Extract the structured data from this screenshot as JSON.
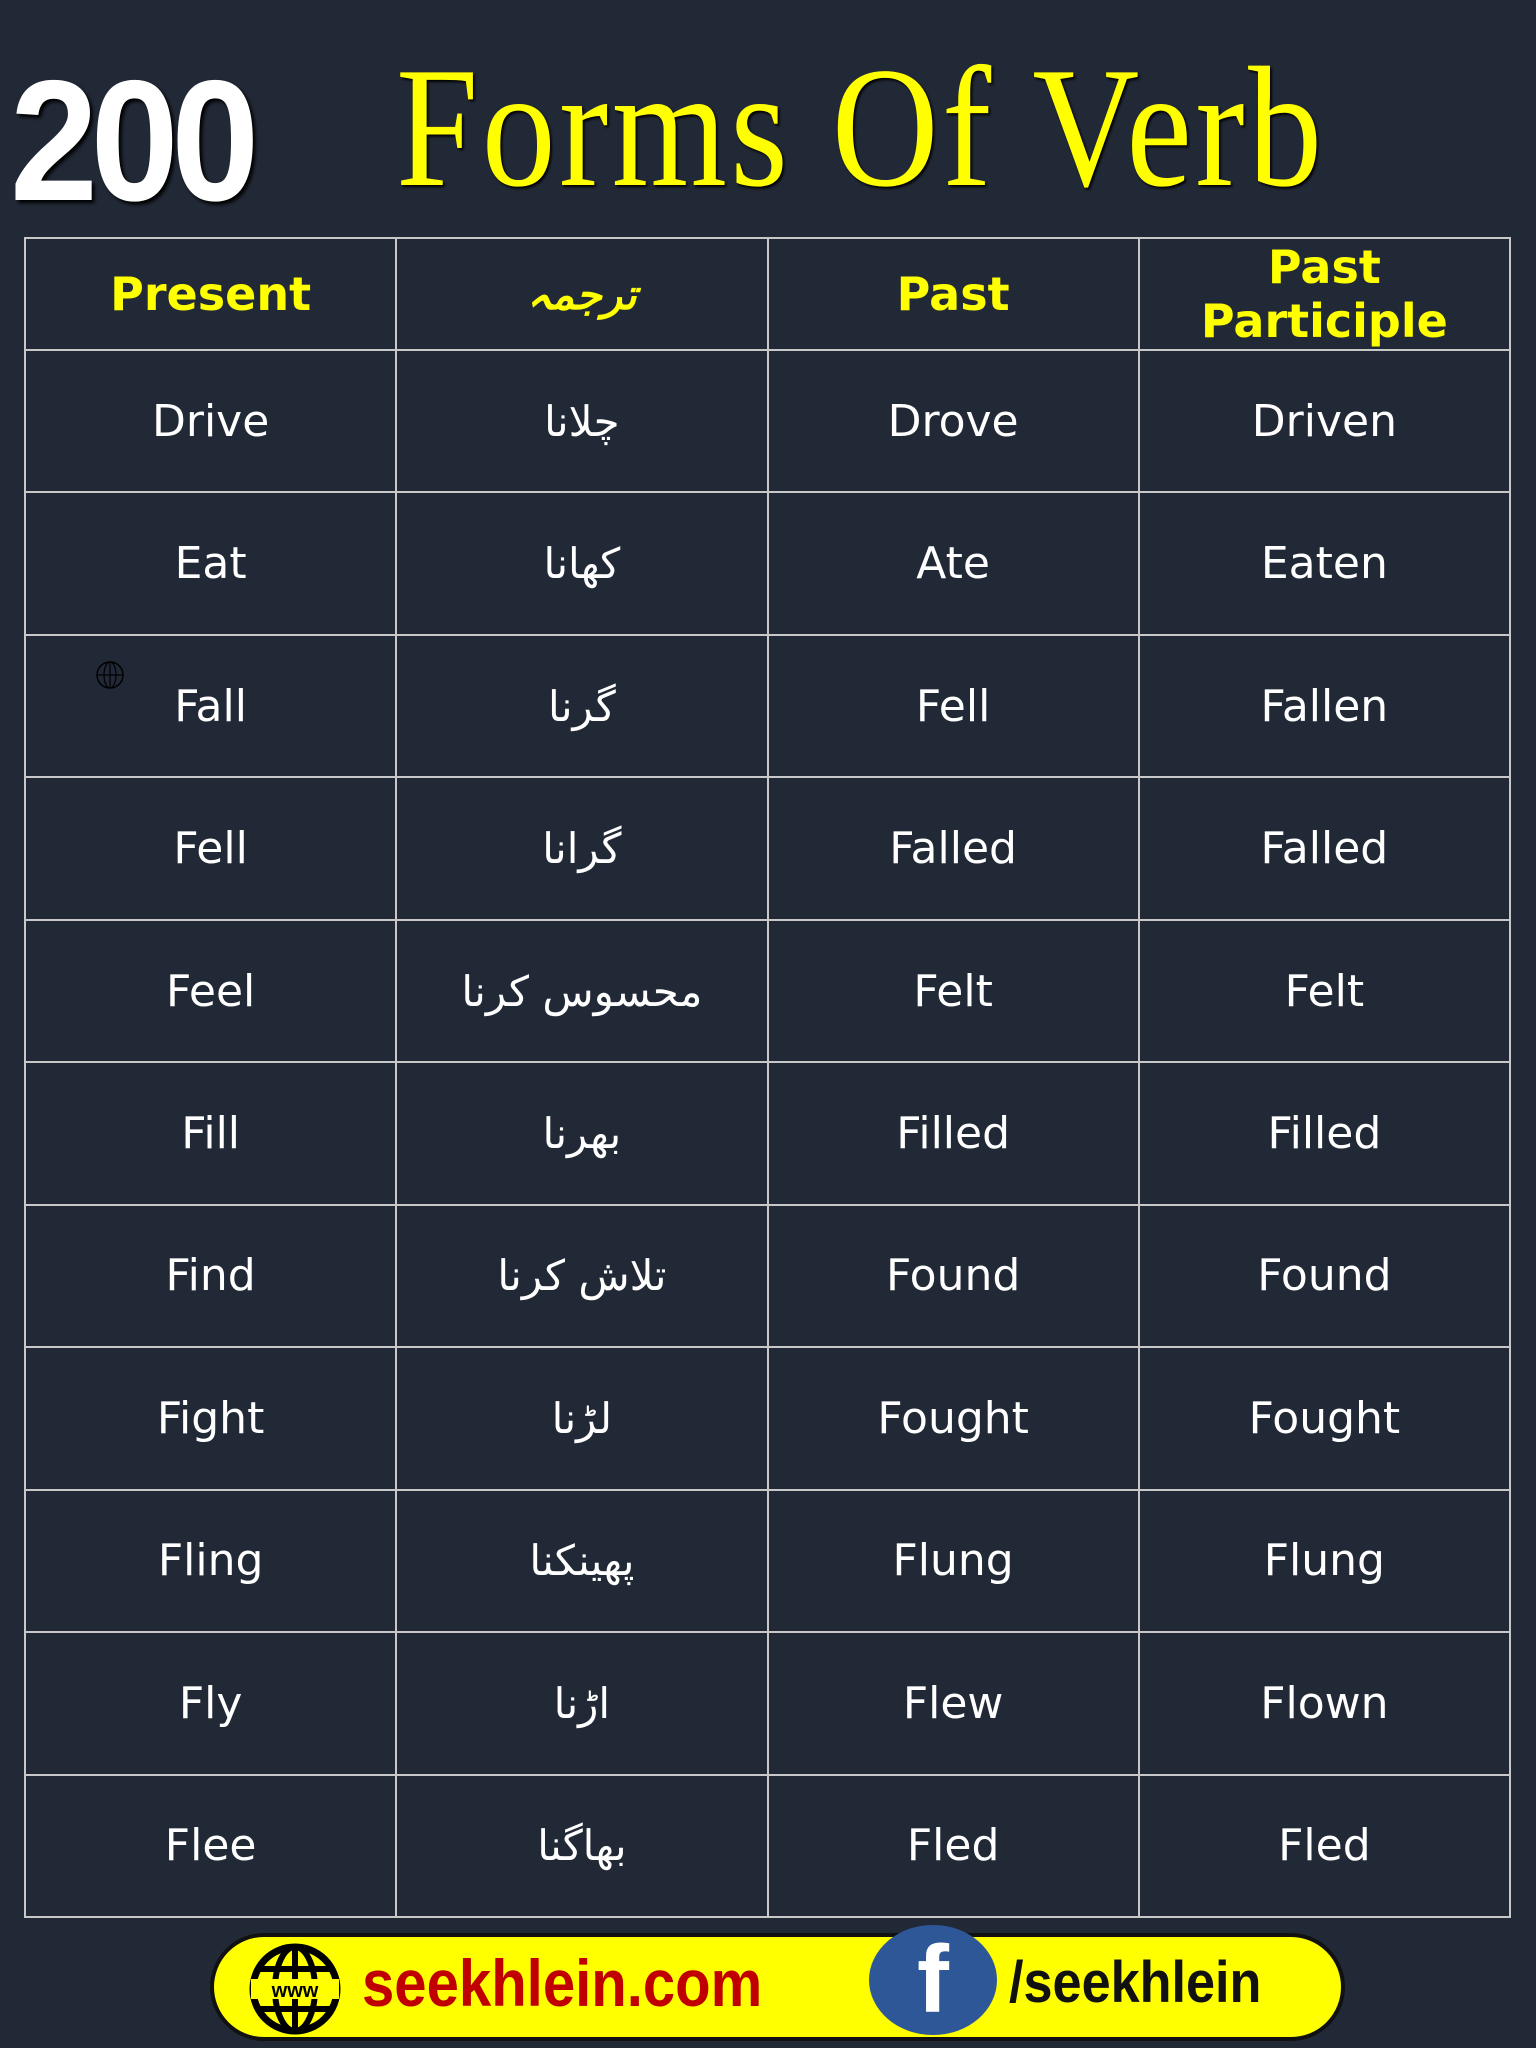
{
  "title": {
    "number": "200",
    "text": "Forms Of Verb"
  },
  "table": {
    "headers": [
      "Present",
      "ترجمہ",
      "Past",
      "Past Participle"
    ],
    "rows": [
      [
        "Drive",
        "چلانا",
        "Drove",
        "Driven"
      ],
      [
        "Eat",
        "کھانا",
        "Ate",
        "Eaten"
      ],
      [
        "Fall",
        "گرنا",
        "Fell",
        "Fallen"
      ],
      [
        "Fell",
        "گرانا",
        "Falled",
        "Falled"
      ],
      [
        "Feel",
        "محسوس کرنا",
        "Felt",
        "Felt"
      ],
      [
        "Fill",
        "بھرنا",
        "Filled",
        "Filled"
      ],
      [
        "Find",
        "تلاش کرنا",
        "Found",
        "Found"
      ],
      [
        "Fight",
        "لڑنا",
        "Fought",
        "Fought"
      ],
      [
        "Fling",
        "پھینکنا",
        "Flung",
        "Flung"
      ],
      [
        "Fly",
        "اڑنا",
        "Flew",
        "Flown"
      ],
      [
        "Flee",
        "بھاگنا",
        "Fled",
        "Fled"
      ]
    ]
  },
  "footer": {
    "globe_label": "www",
    "website": "seekhlein.com",
    "facebook_icon": "f",
    "facebook_handle": "/seekhlein"
  },
  "icons": {
    "watermark": "www-globe-icon",
    "footer_globe": "www-globe-icon",
    "facebook": "facebook-icon"
  },
  "colors": {
    "background": "#222936",
    "accent": "#ffff00",
    "website": "#c00000",
    "facebook": "#2d5797"
  }
}
